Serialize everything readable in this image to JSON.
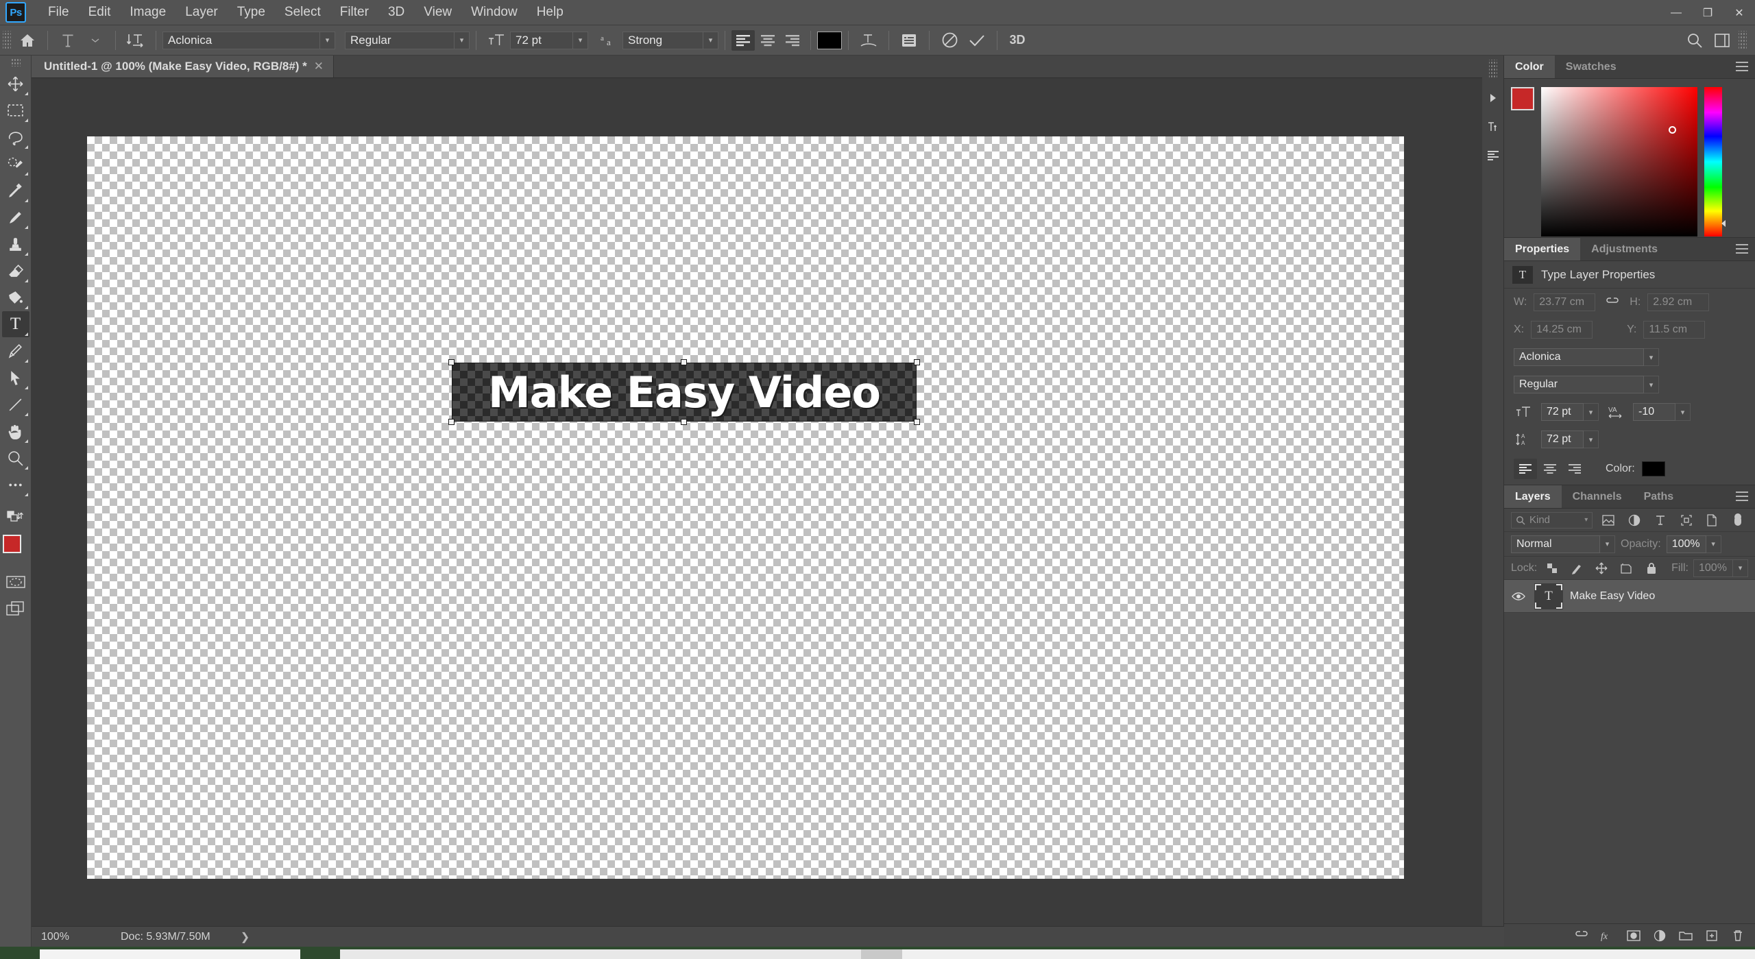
{
  "app": {
    "name": "Photoshop",
    "logo_text": "Ps"
  },
  "menubar": {
    "items": [
      {
        "label": "File"
      },
      {
        "label": "Edit"
      },
      {
        "label": "Image"
      },
      {
        "label": "Layer"
      },
      {
        "label": "Type"
      },
      {
        "label": "Select"
      },
      {
        "label": "Filter"
      },
      {
        "label": "3D"
      },
      {
        "label": "View"
      },
      {
        "label": "Window"
      },
      {
        "label": "Help"
      }
    ],
    "window_controls": {
      "minimize": "—",
      "maximize": "❐",
      "close": "✕"
    }
  },
  "options_bar": {
    "home_icon": "home-icon",
    "tool_preset_icon": "type-tool-icon",
    "orientation_icon": "text-orientation-icon",
    "font_family": "Aclonica",
    "font_style": "Regular",
    "font_size": "72 pt",
    "antialias_icon": "aa-icon",
    "antialias": "Strong",
    "align": {
      "options": [
        "left",
        "center",
        "right"
      ],
      "selected": "left"
    },
    "color_swatch": "#000000",
    "warp_icon": "warp-text-icon",
    "panels_icon": "character-panel-icon",
    "cancel_icon": "cancel-icon",
    "commit_icon": "commit-checkmark-icon",
    "three_d_label": "3D",
    "search_icon": "search-icon",
    "workspace_icon": "workspace-icon"
  },
  "toolbar": {
    "tools": [
      {
        "name": "move-tool",
        "icon": "move",
        "active": false
      },
      {
        "name": "rectangular-select-tool",
        "icon": "marquee",
        "active": false
      },
      {
        "name": "lasso-tool",
        "icon": "lasso",
        "active": false
      },
      {
        "name": "quick-selection-tool",
        "icon": "quickselect",
        "active": false
      },
      {
        "name": "eyedropper-tool",
        "icon": "eyedropper",
        "active": false
      },
      {
        "name": "brush-tool",
        "icon": "brush",
        "active": false
      },
      {
        "name": "clone-stamp-tool",
        "icon": "stamp",
        "active": false
      },
      {
        "name": "eraser-tool",
        "icon": "eraser",
        "active": false
      },
      {
        "name": "gradient-tool",
        "icon": "gradient",
        "active": false
      },
      {
        "name": "type-tool",
        "icon": "type",
        "active": true
      },
      {
        "name": "pen-tool",
        "icon": "pen",
        "active": false
      },
      {
        "name": "path-selection-tool",
        "icon": "arrow",
        "active": false
      },
      {
        "name": "line-tool",
        "icon": "line",
        "active": false
      },
      {
        "name": "hand-tool",
        "icon": "hand",
        "active": false
      },
      {
        "name": "zoom-tool",
        "icon": "zoom",
        "active": false
      },
      {
        "name": "edit-toolbar",
        "icon": "ellipsis",
        "active": false
      }
    ],
    "foreground_color": "#c62828",
    "background_color": "#494949"
  },
  "document": {
    "tab_title": "Untitled-1 @ 100% (Make Easy Video, RGB/8#) *",
    "close_glyph": "✕",
    "artwork_text": "Make Easy Video"
  },
  "color_panel": {
    "tabs": [
      {
        "label": "Color",
        "active": true
      },
      {
        "label": "Swatches",
        "active": false
      }
    ],
    "current_color": "#c62828"
  },
  "properties_panel": {
    "tabs": [
      {
        "label": "Properties",
        "active": true
      },
      {
        "label": "Adjustments",
        "active": false
      }
    ],
    "header": "Type Layer Properties",
    "header_icon": "type-layer-icon",
    "w_label": "W:",
    "w_value": "23.77 cm",
    "link_icon": "link-icon",
    "h_label": "H:",
    "h_value": "2.92 cm",
    "x_label": "X:",
    "x_value": "14.25 cm",
    "y_label": "Y:",
    "y_value": "11.5 cm",
    "font_family": "Aclonica",
    "font_style": "Regular",
    "size_icon": "font-size-icon",
    "font_size": "72 pt",
    "tracking_icon": "tracking-icon",
    "tracking": "-10",
    "leading_icon": "leading-icon",
    "leading": "72 pt",
    "align": {
      "options": [
        "left",
        "center",
        "right"
      ],
      "selected": "left"
    },
    "color_label": "Color:",
    "color_value": "#000000"
  },
  "layers_panel": {
    "tabs": [
      {
        "label": "Layers",
        "active": true
      },
      {
        "label": "Channels",
        "active": false
      },
      {
        "label": "Paths",
        "active": false
      }
    ],
    "filter_placeholder": "Kind",
    "filter_icons": [
      "pixel-filter-icon",
      "adjustment-filter-icon",
      "type-filter-icon",
      "shape-filter-icon",
      "smart-object-filter-icon"
    ],
    "filter_toggle_icon": "filter-toggle-icon",
    "blend_mode": "Normal",
    "opacity_label": "Opacity:",
    "opacity_value": "100%",
    "lock_label": "Lock:",
    "lock_icons": [
      "lock-transparent-icon",
      "lock-image-icon",
      "lock-position-icon",
      "lock-artboard-icon",
      "lock-all-icon"
    ],
    "fill_label": "Fill:",
    "fill_value": "100%",
    "layers": [
      {
        "name": "Make Easy Video",
        "visible": true,
        "type_icon": "type-layer-icon",
        "selected": true
      }
    ],
    "footer_icons": [
      "link-layers-icon",
      "layer-fx-icon",
      "layer-mask-icon",
      "adjustment-layer-icon",
      "new-group-icon",
      "new-layer-icon",
      "delete-layer-icon"
    ]
  },
  "status_bar": {
    "zoom": "100%",
    "doc_info": "Doc: 5.93M/7.50M",
    "expand_glyph": "❯"
  }
}
